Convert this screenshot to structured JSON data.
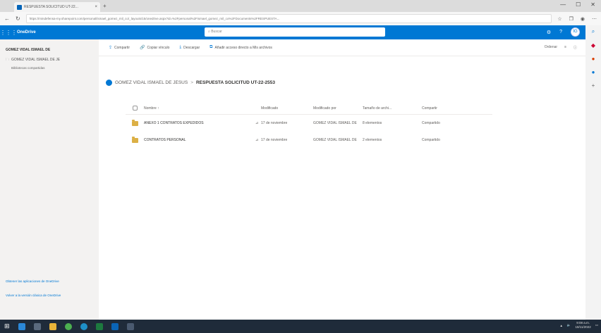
{
  "browser": {
    "tab_title": "RESPUESTA SOLICITUD UT-22...",
    "tab_close": "×",
    "new_tab": "+",
    "window_buttons": [
      "—",
      "☐",
      "✕"
    ],
    "url": "https://mindefensa-my.sharepoint.com/personal/ismael_gomez_mil_co/_layouts/15/onedrive.aspx?id=%2Fpersonal%2Fismael_gomez_mil_co%2FDocuments%2FRESPUESTA..."
  },
  "suitebar": {
    "app_name": "OneDrive",
    "search_placeholder": "Buscar",
    "avatar_initials": "IG"
  },
  "sidebar": {
    "user_name": "GOMEZ VIDAL ISMAEL DE",
    "item_label": "GOMEZ VIDAL ISMAEL DE JE",
    "sub_label": "Bibliotecas compartidas",
    "footer_link1": "Obtener las aplicaciones de OneDrive",
    "footer_link2": "Volver a la versión clásica de OneDrive"
  },
  "commandbar": {
    "share": "Compartir",
    "copy_link": "Copiar vínculo",
    "download": "Descargar",
    "add_shortcut": "Añadir acceso directo a Mis archivos",
    "sort": "Ordenar",
    "view": "≡",
    "info": "ⓘ"
  },
  "breadcrumb": {
    "parent": "GOMEZ VIDAL ISMAEL DE JESUS",
    "separator": ">",
    "current": "RESPUESTA SOLICITUD UT-22-2553"
  },
  "table": {
    "headers": {
      "name": "Nombre ↑",
      "modified": "Modificado",
      "modified_by": "Modificado por",
      "size": "Tamaño de archi...",
      "sharing": "Compartir"
    },
    "rows": [
      {
        "name": "ANEXO 1 CONTRATOS EXPEDIDOS",
        "modified": "17 de noviembre",
        "modified_by": "GOMEZ VIDAL ISMAEL DE",
        "size": "8 elementos",
        "sharing": "Compartido"
      },
      {
        "name": "CONTRATOS PERSONAL",
        "modified": "17 de noviembre",
        "modified_by": "GOMEZ VIDAL ISMAEL DE",
        "size": "2 elementos",
        "sharing": "Compartido"
      }
    ]
  },
  "taskbar": {
    "time": "9:08 a.m.",
    "date": "18/11/2022"
  },
  "colors": {
    "brand": "#0078d4",
    "folder": "#dcb046",
    "taskbar": "#1f2b3a"
  }
}
